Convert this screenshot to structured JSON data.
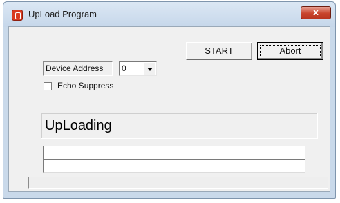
{
  "window": {
    "title": "UpLoad Program",
    "close_glyph": "x"
  },
  "toolbar": {
    "start_label": "START",
    "abort_label": "Abort"
  },
  "device": {
    "label": "Device Address",
    "selected_value": "0"
  },
  "echo": {
    "label": "Echo Suppress",
    "checked": false
  },
  "status": {
    "text": "UpLoading"
  },
  "icons": {
    "app": "app-icon",
    "close": "close-icon",
    "dropdown": "chevron-down-icon",
    "checkbox": "checkbox-icon"
  },
  "colors": {
    "title_bar": "#c9d9ea",
    "close_button": "#c9452e",
    "dialog_background": "#f0f0f0"
  }
}
